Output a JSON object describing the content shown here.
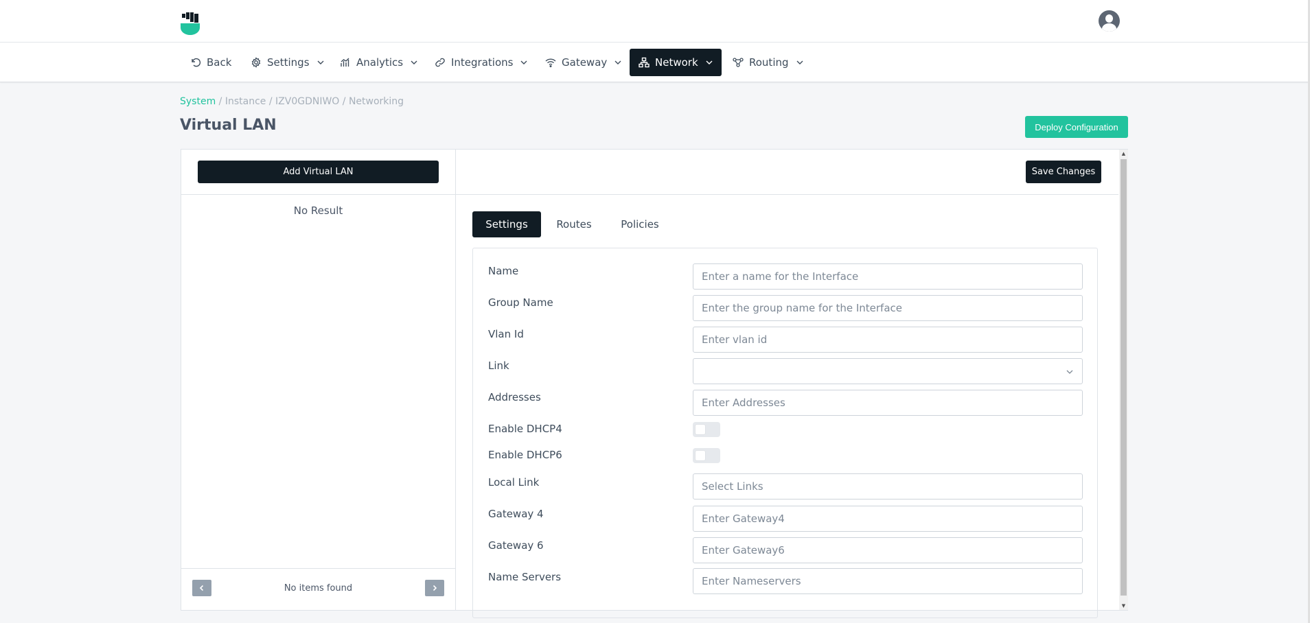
{
  "nav": {
    "back": "Back",
    "settings": "Settings",
    "analytics": "Analytics",
    "integrations": "Integrations",
    "gateway": "Gateway",
    "network": "Network",
    "routing": "Routing"
  },
  "breadcrumb": {
    "system": "System",
    "instance": "Instance",
    "instance_id": "IZV0GDNIWO",
    "networking": "Networking",
    "separator": "/"
  },
  "page": {
    "title": "Virtual LAN",
    "deploy_label": "Deploy Configuration"
  },
  "left_panel": {
    "add_label": "Add Virtual LAN",
    "empty_text": "No Result",
    "footer_text": "No items found"
  },
  "right_panel": {
    "save_label": "Save Changes",
    "tabs": [
      "Settings",
      "Routes",
      "Policies"
    ],
    "active_tab": "Settings"
  },
  "form": {
    "name": {
      "label": "Name",
      "placeholder": "Enter a name for the Interface",
      "value": ""
    },
    "group_name": {
      "label": "Group Name",
      "placeholder": "Enter the group name for the Interface",
      "value": ""
    },
    "vlan_id": {
      "label": "Vlan Id",
      "placeholder": "Enter vlan id",
      "value": ""
    },
    "link": {
      "label": "Link",
      "value": ""
    },
    "addresses": {
      "label": "Addresses",
      "placeholder": "Enter Addresses",
      "value": ""
    },
    "enable_dhcp4": {
      "label": "Enable DHCP4",
      "enabled": false
    },
    "enable_dhcp6": {
      "label": "Enable DHCP6",
      "enabled": false
    },
    "local_link": {
      "label": "Local Link",
      "placeholder": "Select Links",
      "value": ""
    },
    "gateway4": {
      "label": "Gateway 4",
      "placeholder": "Enter Gateway4",
      "value": ""
    },
    "gateway6": {
      "label": "Gateway 6",
      "placeholder": "Enter Gateway6",
      "value": ""
    },
    "name_servers": {
      "label": "Name Servers",
      "placeholder": "Enter Nameservers",
      "value": ""
    }
  },
  "icons": {
    "logo": "fist-shield-logo",
    "avatar": "user-avatar-icon",
    "back": "undo-icon",
    "settings": "gear-icon",
    "analytics": "bar-chart-icon",
    "integrations": "link-icon",
    "gateway": "wifi-icon",
    "network": "network-icon",
    "routing": "routing-icon",
    "chevron": "chevron-down-icon",
    "pager_prev": "chevron-left-icon",
    "pager_next": "chevron-right-icon"
  },
  "colors": {
    "accent": "#22c39e",
    "dark": "#111c24",
    "muted": "#a7b0ba",
    "title": "#4a5566"
  }
}
